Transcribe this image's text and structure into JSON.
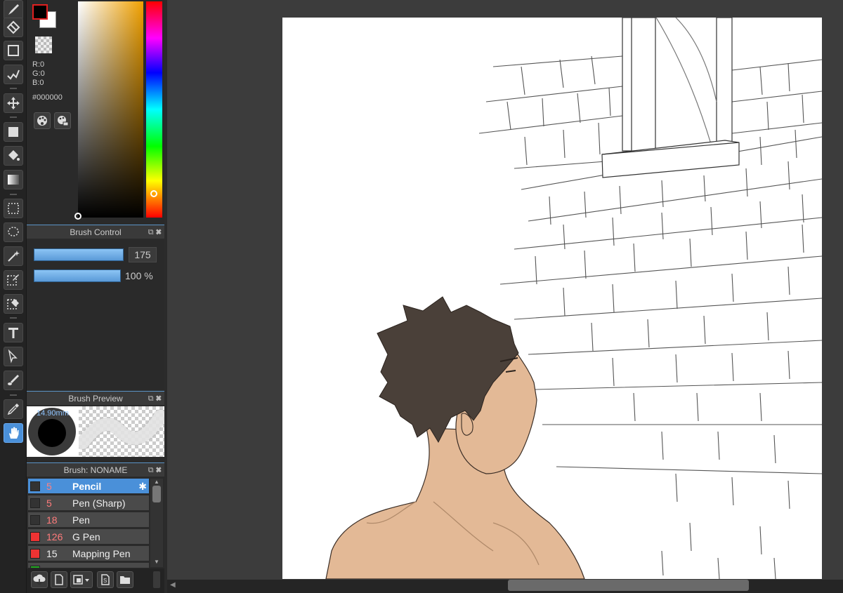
{
  "color_panel": {
    "r": "R:0",
    "g": "G:0",
    "b": "B:0",
    "hex": "#000000",
    "foreground": "#000000",
    "background": "#ffffff"
  },
  "brush_control": {
    "title": "Brush Control",
    "size_value": "175",
    "opacity_value": "100 %"
  },
  "brush_preview": {
    "title": "Brush Preview",
    "size_label": "14.90mm"
  },
  "brush_list": {
    "title": "Brush: NONAME",
    "items": [
      {
        "size": "5",
        "name": "Pencil",
        "swatch": "#333333",
        "selected": true
      },
      {
        "size": "5",
        "name": "Pen (Sharp)",
        "swatch": "#333333"
      },
      {
        "size": "18",
        "name": "Pen",
        "swatch": "#333333"
      },
      {
        "size": "126",
        "name": "G Pen",
        "swatch": "#ee3333"
      },
      {
        "size": "15",
        "name": "Mapping Pen",
        "swatch": "#ee3333"
      }
    ]
  },
  "tools": [
    "brush-icon",
    "eraser-icon",
    "rectangle-icon",
    "pen-stroke-icon",
    "move-icon",
    "fill-rect-icon",
    "bucket-icon",
    "gradient-icon",
    "rect-select-icon",
    "lasso-icon",
    "magic-wand-icon",
    "select-pen-icon",
    "select-eraser-icon",
    "text-icon",
    "operation-icon",
    "blur-icon",
    "eyedropper-icon",
    "hand-icon"
  ]
}
